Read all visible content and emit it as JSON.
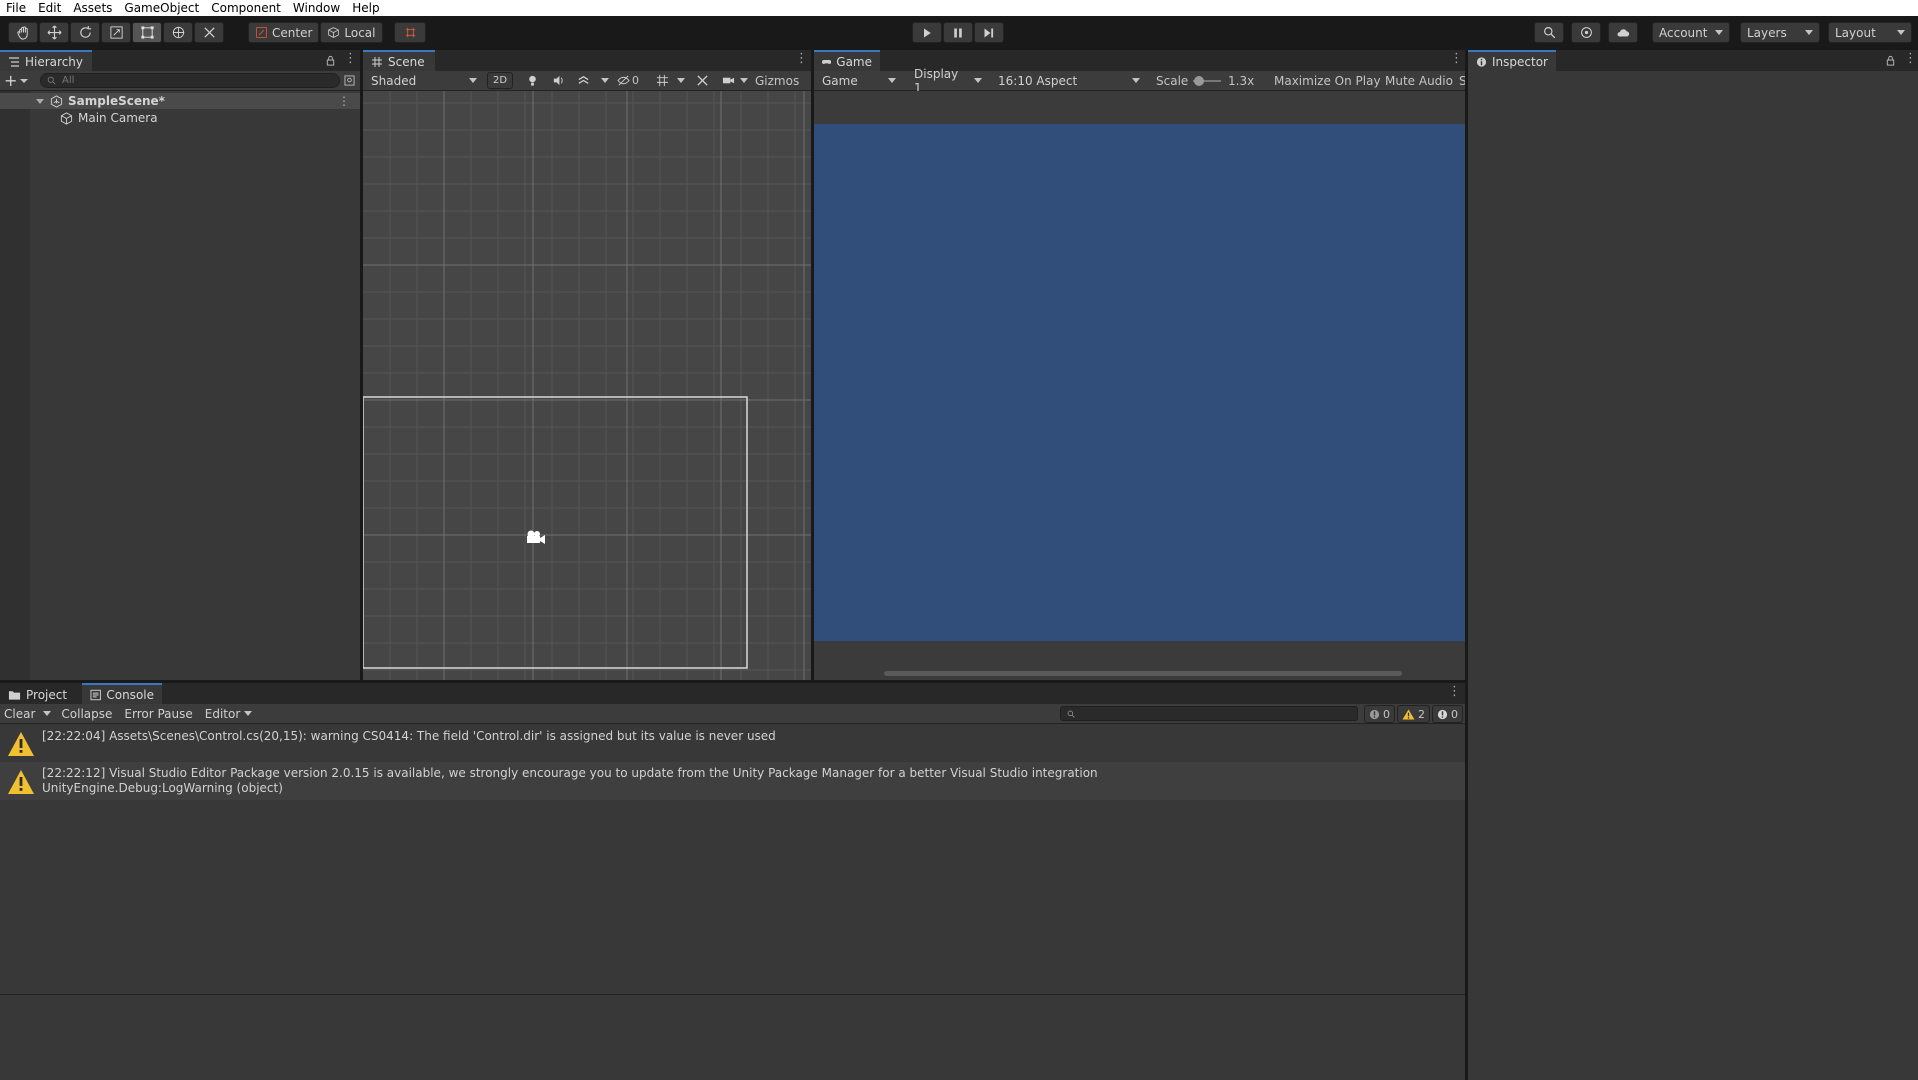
{
  "menu": [
    "File",
    "Edit",
    "Assets",
    "GameObject",
    "Component",
    "Window",
    "Help"
  ],
  "toolbar": {
    "pivot_label": "Center",
    "space_label": "Local",
    "account_label": "Account",
    "layers_label": "Layers",
    "layout_label": "Layout",
    "icons": [
      "hand-tool-icon",
      "move-tool-icon",
      "rotate-tool-icon",
      "scale-tool-icon",
      "rect-tool-icon",
      "transform-tool-icon",
      "custom-tool-icon",
      "grid-snap-icon",
      "play-icon",
      "pause-icon",
      "step-icon",
      "search-icon",
      "collab-icon",
      "cloud-icon"
    ]
  },
  "hierarchy": {
    "tab_label": "Hierarchy",
    "search_placeholder": "All",
    "scene_name": "SampleScene*",
    "items": [
      "Main Camera"
    ]
  },
  "scene": {
    "tab_label": "Scene",
    "shading": "Shaded",
    "mode_2d": "2D",
    "hidden_count": "0",
    "gizmos_label": "Gizmos"
  },
  "game": {
    "tab_label": "Game",
    "view_select": "Game",
    "display": "Display 1",
    "aspect": "16:10 Aspect",
    "scale_label": "Scale",
    "scale_value": "1.3x",
    "maximize_label": "Maximize On Play",
    "mute_label": "Mute Audio",
    "overflow_label": "S",
    "background_color": "#314d79"
  },
  "inspector": {
    "tab_label": "Inspector"
  },
  "console": {
    "project_tab": "Project",
    "console_tab": "Console",
    "clear_label": "Clear",
    "collapse_label": "Collapse",
    "error_pause_label": "Error Pause",
    "editor_label": "Editor",
    "log_count": "0",
    "warning_count": "2",
    "error_count": "0",
    "entries": [
      {
        "line1": "[22:22:04] Assets\\Scenes\\Control.cs(20,15): warning CS0414: The field 'Control.dir' is assigned but its value is never used",
        "line2": ""
      },
      {
        "line1": "[22:22:12] Visual Studio Editor Package version 2.0.15 is available, we strongly encourage you to update from the Unity Package Manager for a better Visual Studio integration",
        "line2": "UnityEngine.Debug:LogWarning (object)"
      }
    ]
  },
  "colors": {
    "accent": "#3a79bb",
    "warning": "#f0c030",
    "game_bg": "#314d79"
  }
}
